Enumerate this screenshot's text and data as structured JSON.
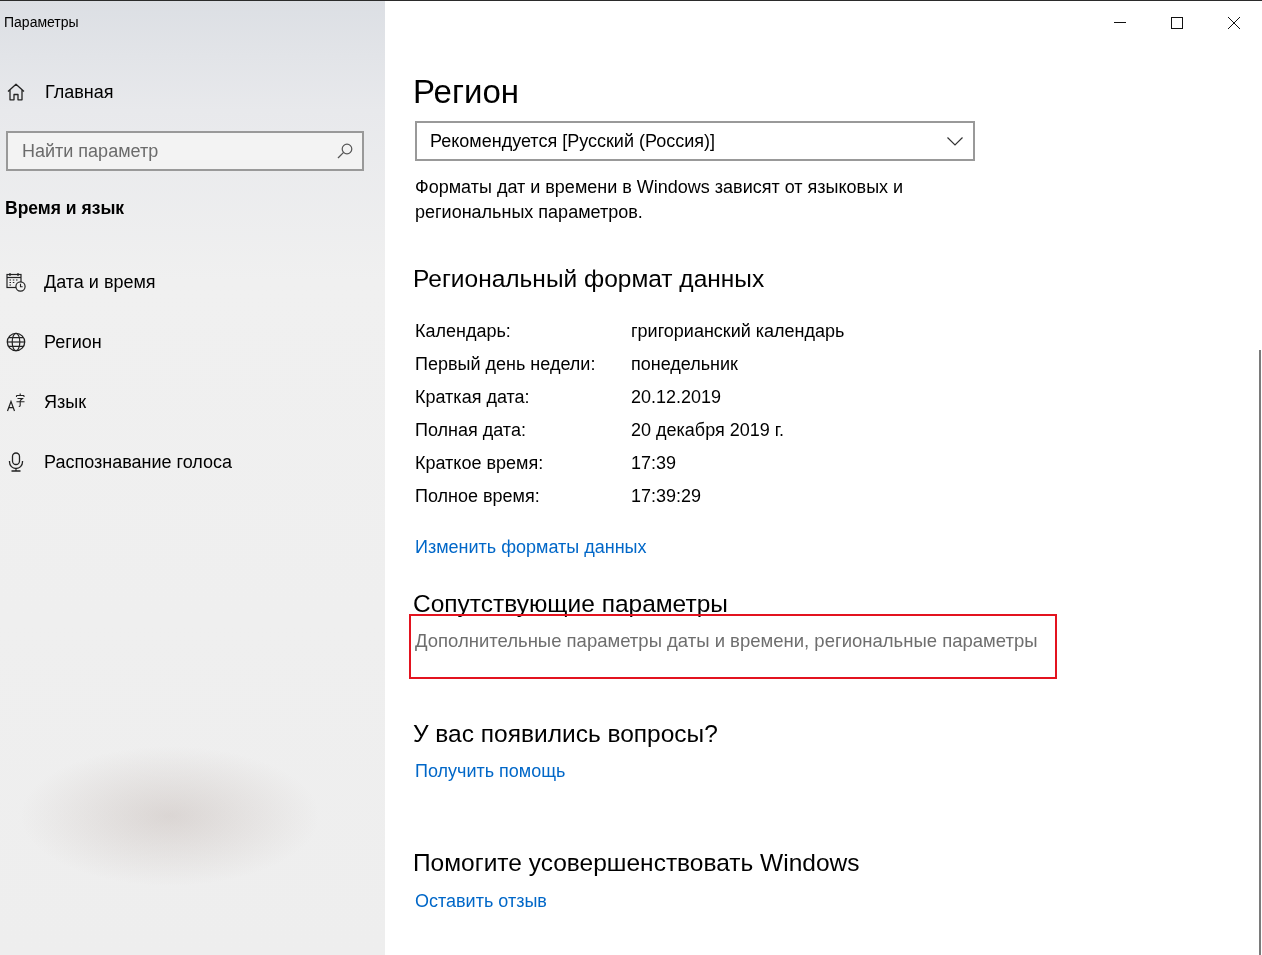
{
  "window": {
    "title": "Параметры"
  },
  "sidebar": {
    "home": {
      "label": "Главная"
    },
    "search": {
      "placeholder": "Найти параметр"
    },
    "section_title": "Время и язык",
    "items": [
      {
        "label": "Дата и время",
        "selected": false
      },
      {
        "label": "Регион",
        "selected": false
      },
      {
        "label": "Язык",
        "selected": false
      },
      {
        "label": "Распознавание голоса",
        "selected": false
      }
    ]
  },
  "main": {
    "title": "Регион",
    "region_dropdown": {
      "value": "Рекомендуется [Русский (Россия)]"
    },
    "description": "Форматы дат и времени в Windows зависят от языковых и региональных параметров.",
    "regional_format": {
      "title": "Региональный формат данных",
      "rows": [
        {
          "label": "Календарь:",
          "value": "григорианский календарь"
        },
        {
          "label": "Первый день недели:",
          "value": "понедельник"
        },
        {
          "label": "Краткая дата:",
          "value": "20.12.2019"
        },
        {
          "label": "Полная дата:",
          "value": "20 декабря 2019 г."
        },
        {
          "label": "Краткое время:",
          "value": "17:39"
        },
        {
          "label": "Полное время:",
          "value": "17:39:29"
        }
      ],
      "link": "Изменить форматы данных"
    },
    "related_settings": {
      "title": "Сопутствующие параметры",
      "link": {
        "label": "Дополнительные параметры даты и времени, региональные параметры",
        "highlighted": true
      }
    },
    "questions": {
      "title": "У вас появились вопросы?",
      "link": "Получить помощь"
    },
    "feedback": {
      "title": "Помогите усовершенствовать Windows",
      "link": "Оставить отзыв"
    }
  }
}
